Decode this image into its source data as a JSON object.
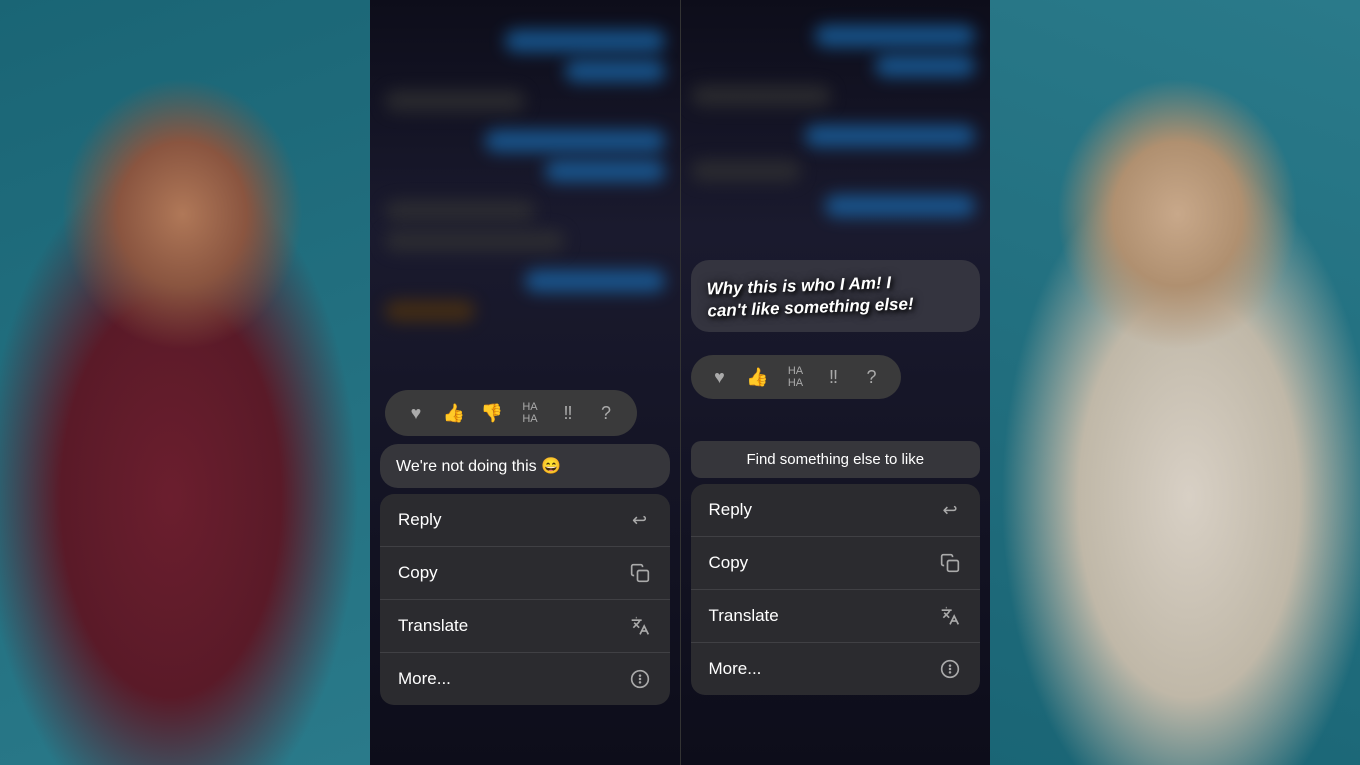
{
  "background": {
    "color": "#2a7a8a"
  },
  "phone_left": {
    "message": {
      "text": "We're not doing this 😄",
      "emoji": "😄"
    },
    "reaction_bar": {
      "icons": [
        "♥",
        "👍",
        "👎",
        "HA\nHA",
        "!!",
        "?"
      ]
    },
    "context_menu": {
      "items": [
        {
          "label": "Reply",
          "icon": "reply"
        },
        {
          "label": "Copy",
          "icon": "copy"
        },
        {
          "label": "Translate",
          "icon": "translate"
        },
        {
          "label": "More...",
          "icon": "more"
        }
      ]
    }
  },
  "phone_right": {
    "handwritten_text": "Why this is who I Am! I can't like something else!",
    "tooltip": "Find something else to like",
    "context_menu": {
      "items": [
        {
          "label": "Reply",
          "icon": "reply"
        },
        {
          "label": "Copy",
          "icon": "copy"
        },
        {
          "label": "Translate",
          "icon": "translate"
        },
        {
          "label": "More...",
          "icon": "more"
        }
      ]
    }
  }
}
